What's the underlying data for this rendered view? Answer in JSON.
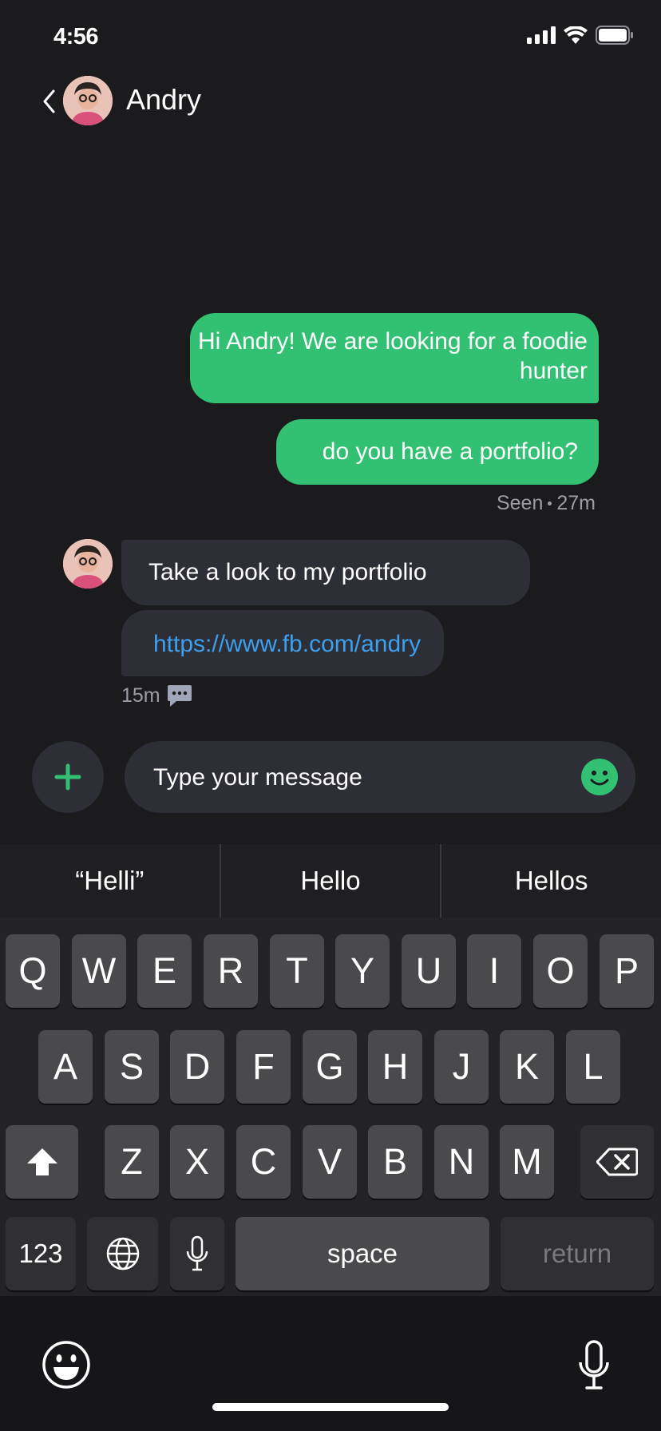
{
  "status_bar": {
    "time": "4:56"
  },
  "header": {
    "contact_name": "Andry"
  },
  "messages": {
    "outgoing_1": "Hi Andry! We are looking for a foodie hunter",
    "outgoing_2": "do you have a portfolio?",
    "seen_label": "Seen",
    "seen_time": "27m",
    "incoming_1": "Take a look to my portfolio",
    "incoming_2_link": "https://www.fb.com/andry",
    "incoming_time": "15m"
  },
  "composer": {
    "placeholder": "Type your message"
  },
  "keyboard": {
    "suggestions": [
      "“Helli”",
      "Hello",
      "Hellos"
    ],
    "row1": [
      "Q",
      "W",
      "E",
      "R",
      "T",
      "Y",
      "U",
      "I",
      "O",
      "P"
    ],
    "row2": [
      "A",
      "S",
      "D",
      "F",
      "G",
      "H",
      "J",
      "K",
      "L"
    ],
    "row3": [
      "Z",
      "X",
      "C",
      "V",
      "B",
      "N",
      "M"
    ],
    "numbers_label": "123",
    "space_label": "space",
    "return_label": "return"
  },
  "colors": {
    "background": "#1b1b1d",
    "accent_green": "#32c173",
    "incoming_bubble": "#2d2e36",
    "link_blue": "#3aa0ef"
  },
  "icons": [
    "back-chevron-icon",
    "signal-icon",
    "wifi-icon",
    "battery-icon",
    "chat-icon",
    "plus-icon",
    "smiley-icon",
    "globe-icon",
    "microphone-icon",
    "shift-icon",
    "delete-icon"
  ]
}
